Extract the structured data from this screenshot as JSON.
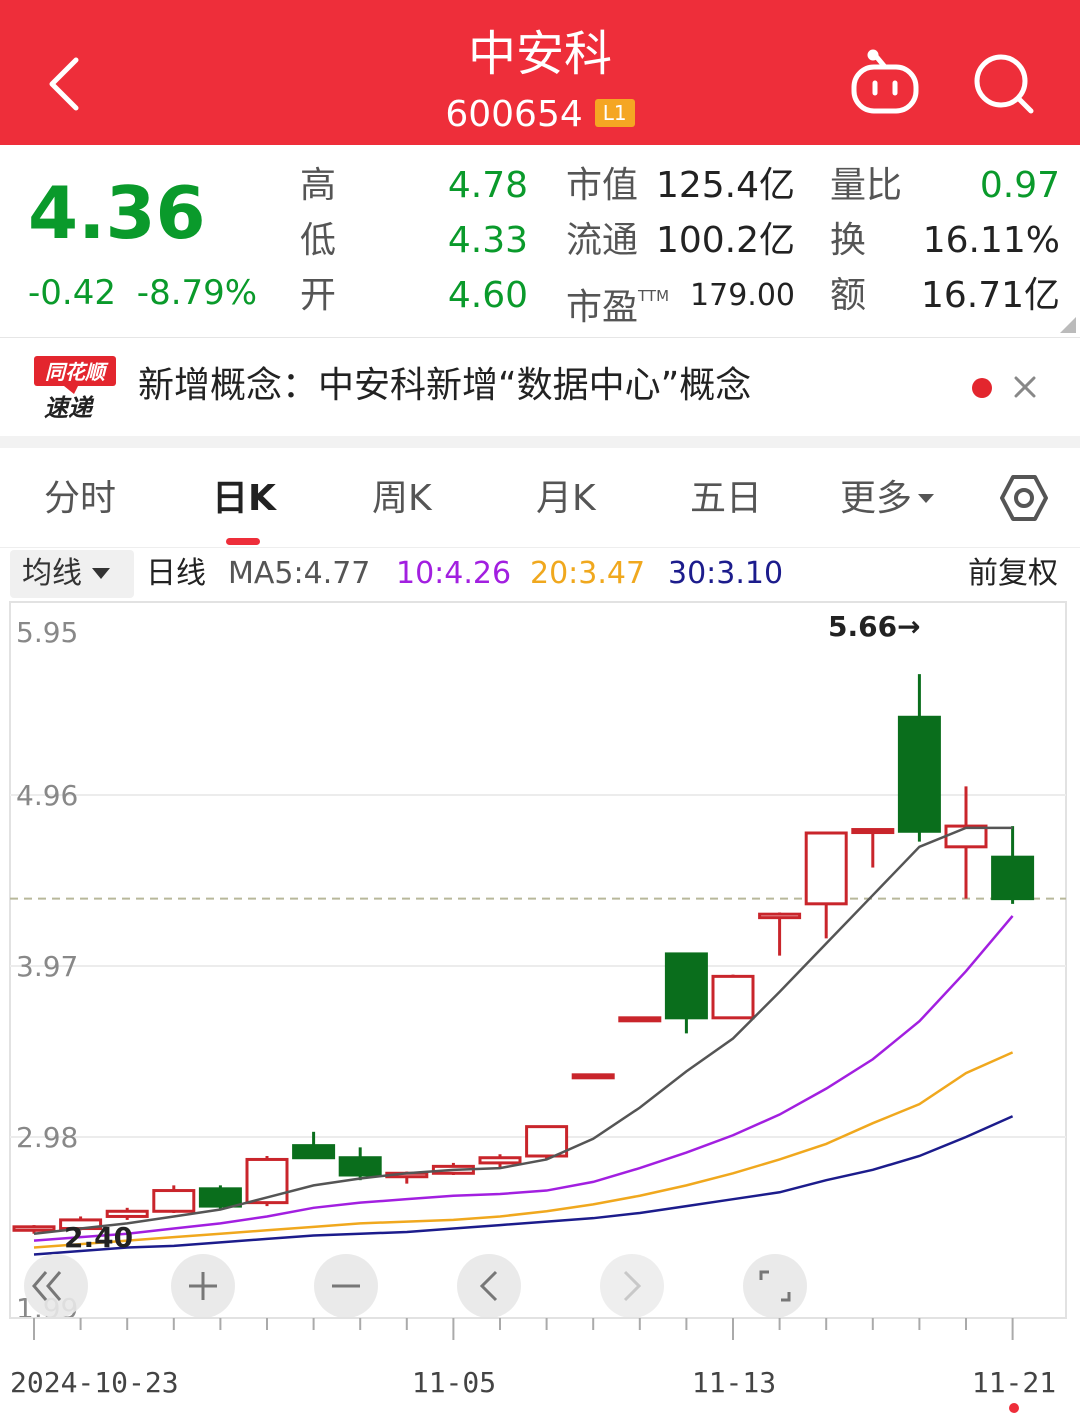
{
  "header": {
    "stock_name": "中安科",
    "stock_code": "600654",
    "level_badge": "L1",
    "back_icon": "chevron-left-icon",
    "robot_icon": "robot-assistant-icon",
    "search_icon": "search-icon"
  },
  "quote": {
    "price": "4.36",
    "change": "-0.42",
    "change_pct": "-8.79%",
    "high_label": "高",
    "high": "4.78",
    "low_label": "低",
    "low": "4.33",
    "open_label": "开",
    "open": "4.60",
    "mktcap_label": "市值",
    "mktcap": "125.4亿",
    "float_label": "流通",
    "float_cap": "100.2亿",
    "pe_label": "市盈",
    "pe_sup": "TTM",
    "pe": "179.00",
    "vol_ratio_label": "量比",
    "vol_ratio": "0.97",
    "turnover_label": "换",
    "turnover": "16.11%",
    "amount_label": "额",
    "amount": "16.71亿"
  },
  "news": {
    "logo_top": "同花顺",
    "logo_bottom": "速递",
    "text": "新增概念：中安科新增“数据中心”概念",
    "close_icon": "close-icon"
  },
  "tabs": [
    {
      "label": "分时"
    },
    {
      "label": "日K"
    },
    {
      "label": "周K"
    },
    {
      "label": "月K"
    },
    {
      "label": "五日"
    },
    {
      "label": "更多"
    }
  ],
  "settings_icon": "hexagon-settings-icon",
  "ma_bar": {
    "select_label": "均线",
    "period_label": "日线",
    "ma5": "MA5:4.77",
    "ma10": "10:4.26",
    "ma20": "20:3.47",
    "ma30": "30:3.10",
    "adjust": "前复权"
  },
  "colors": {
    "brand_red": "#ee2e3a",
    "up": "#c9252b",
    "down": "#0a6e1c",
    "ma5": "#555555",
    "ma10": "#a21fe0",
    "ma20": "#f0a81e",
    "ma30": "#1c1c8c"
  },
  "chart_data": {
    "type": "candlestick",
    "y_ticks": [
      "5.95",
      "4.96",
      "3.97",
      "2.98",
      "1.99"
    ],
    "x_tick_labels": [
      "2024-10-23",
      "11-05",
      "11-13",
      "11-21"
    ],
    "ylim": [
      1.99,
      5.95
    ],
    "last_close": 4.36,
    "high_annotation": "5.66→",
    "low_annotation": "2.40",
    "candles": [
      {
        "o": 2.44,
        "h": 2.47,
        "l": 2.42,
        "c": 2.46
      },
      {
        "o": 2.45,
        "h": 2.52,
        "l": 2.44,
        "c": 2.5
      },
      {
        "o": 2.52,
        "h": 2.57,
        "l": 2.5,
        "c": 2.55
      },
      {
        "o": 2.55,
        "h": 2.7,
        "l": 2.54,
        "c": 2.67
      },
      {
        "o": 2.68,
        "h": 2.7,
        "l": 2.56,
        "c": 2.58
      },
      {
        "o": 2.6,
        "h": 2.87,
        "l": 2.58,
        "c": 2.85
      },
      {
        "o": 2.93,
        "h": 3.01,
        "l": 2.86,
        "c": 2.86
      },
      {
        "o": 2.86,
        "h": 2.92,
        "l": 2.73,
        "c": 2.76
      },
      {
        "o": 2.75,
        "h": 2.78,
        "l": 2.71,
        "c": 2.77
      },
      {
        "o": 2.77,
        "h": 2.83,
        "l": 2.76,
        "c": 2.81
      },
      {
        "o": 2.83,
        "h": 2.88,
        "l": 2.8,
        "c": 2.86
      },
      {
        "o": 2.87,
        "h": 3.04,
        "l": 2.85,
        "c": 3.04
      },
      {
        "o": 3.34,
        "h": 3.34,
        "l": 3.34,
        "c": 3.34
      },
      {
        "o": 3.67,
        "h": 3.67,
        "l": 3.67,
        "c": 3.67
      },
      {
        "o": 4.04,
        "h": 4.04,
        "l": 3.58,
        "c": 3.67
      },
      {
        "o": 3.67,
        "h": 3.92,
        "l": 3.67,
        "c": 3.91
      },
      {
        "o": 4.25,
        "h": 4.28,
        "l": 4.03,
        "c": 4.27
      },
      {
        "o": 4.33,
        "h": 4.74,
        "l": 4.13,
        "c": 4.74
      },
      {
        "o": 4.76,
        "h": 4.76,
        "l": 4.54,
        "c": 4.76
      },
      {
        "o": 5.41,
        "h": 5.66,
        "l": 4.69,
        "c": 4.75
      },
      {
        "o": 4.66,
        "h": 5.01,
        "l": 4.36,
        "c": 4.78
      },
      {
        "o": 4.6,
        "h": 4.78,
        "l": 4.33,
        "c": 4.36
      }
    ],
    "series": [
      {
        "name": "MA5",
        "values": [
          2.42,
          2.45,
          2.48,
          2.52,
          2.56,
          2.63,
          2.7,
          2.74,
          2.77,
          2.79,
          2.8,
          2.85,
          2.97,
          3.15,
          3.36,
          3.55,
          3.82,
          4.1,
          4.38,
          4.66,
          4.77,
          4.77
        ]
      },
      {
        "name": "10",
        "values": [
          2.38,
          2.4,
          2.42,
          2.45,
          2.48,
          2.52,
          2.57,
          2.6,
          2.62,
          2.64,
          2.65,
          2.67,
          2.72,
          2.8,
          2.89,
          2.99,
          3.11,
          3.26,
          3.43,
          3.65,
          3.94,
          4.26
        ]
      },
      {
        "name": "20",
        "values": [
          2.34,
          2.36,
          2.38,
          2.4,
          2.42,
          2.44,
          2.46,
          2.48,
          2.49,
          2.5,
          2.52,
          2.55,
          2.59,
          2.64,
          2.7,
          2.77,
          2.85,
          2.94,
          3.06,
          3.17,
          3.35,
          3.47
        ]
      },
      {
        "name": "30",
        "values": [
          2.3,
          2.32,
          2.34,
          2.35,
          2.37,
          2.39,
          2.41,
          2.42,
          2.43,
          2.45,
          2.47,
          2.49,
          2.51,
          2.54,
          2.58,
          2.62,
          2.66,
          2.73,
          2.79,
          2.87,
          2.98,
          3.1
        ]
      }
    ]
  }
}
